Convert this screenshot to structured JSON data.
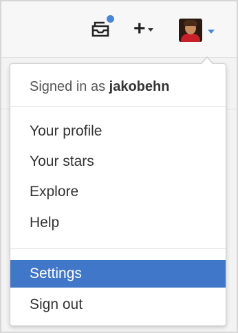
{
  "header": {
    "notifications_icon": "inbox-icon",
    "notification_indicator_color": "#4a86d4",
    "create_icon": "plus-icon",
    "create_label": "+",
    "avatar_icon": "user-avatar",
    "accent_color": "#4a86d4"
  },
  "dropdown": {
    "signed_in_prefix": "Signed in as",
    "username": "jakobehn",
    "items": [
      {
        "label": "Your profile"
      },
      {
        "label": "Your stars"
      },
      {
        "label": "Explore"
      },
      {
        "label": "Help"
      },
      {
        "label": "Settings",
        "active": true
      },
      {
        "label": "Sign out"
      }
    ],
    "active_color": "#4077c9"
  }
}
